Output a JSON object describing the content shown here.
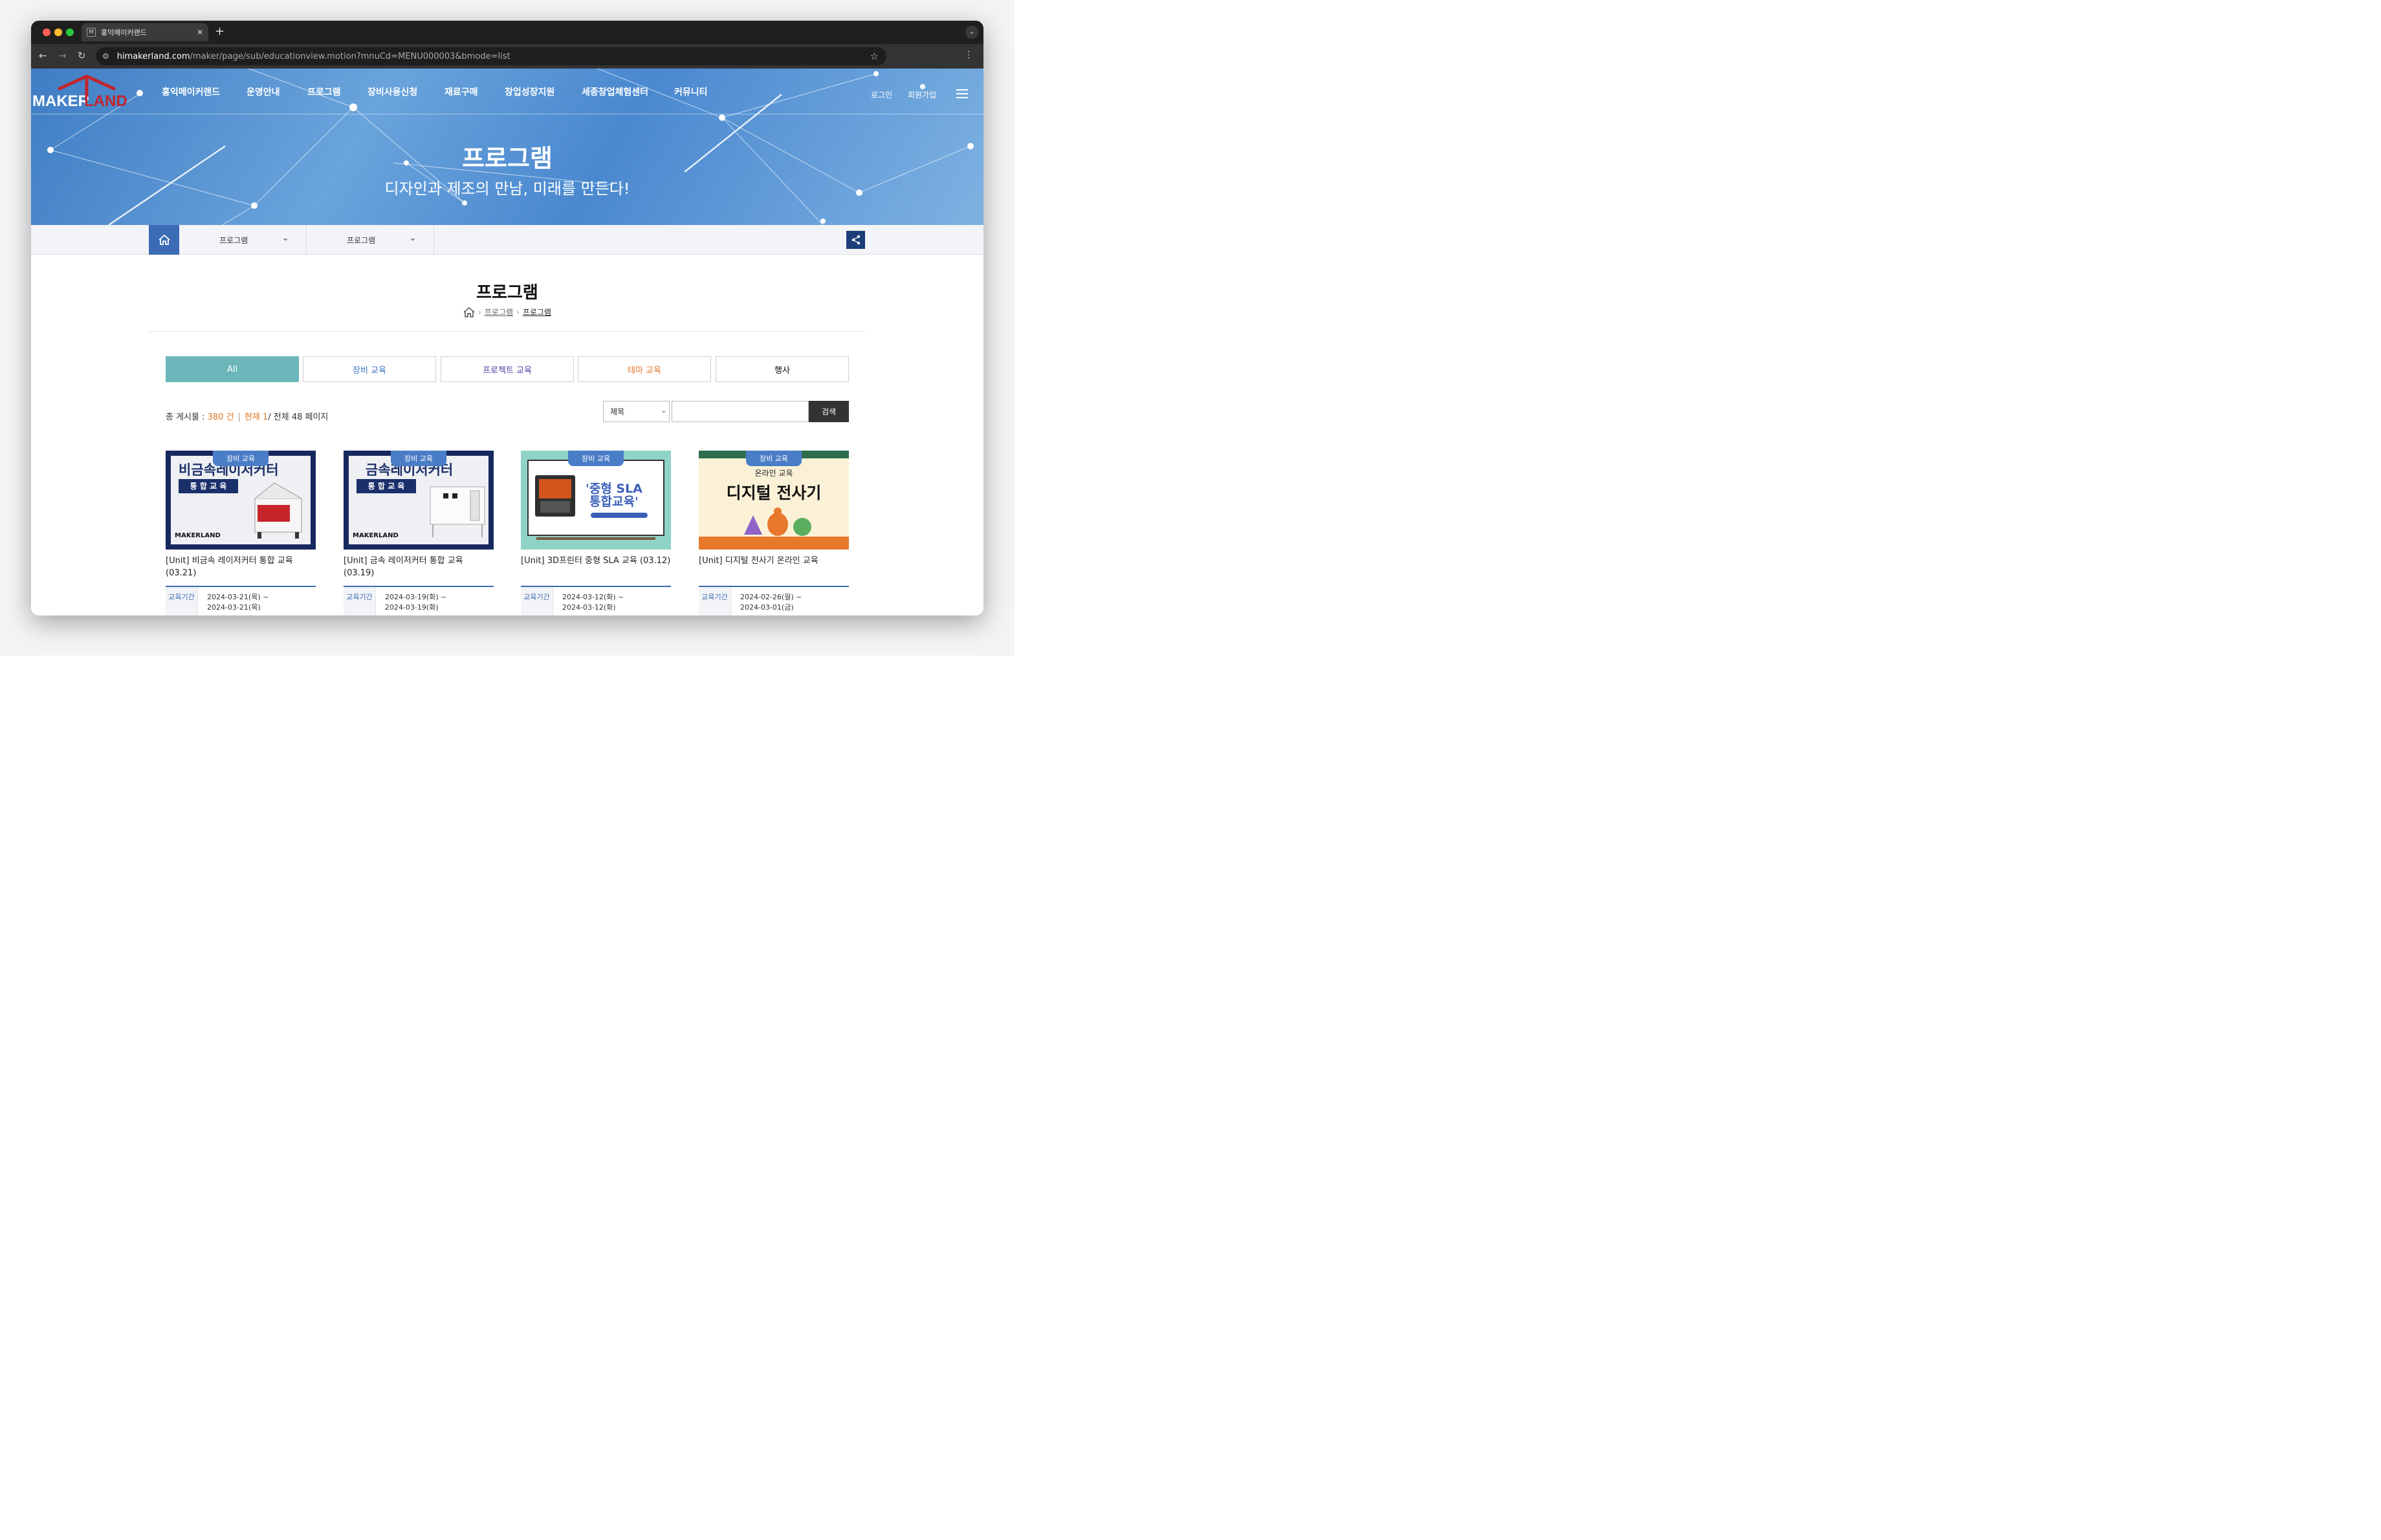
{
  "browser": {
    "tab_title": "홍익메이커랜드",
    "tab_favicon": "M",
    "new_tab": "+",
    "url_host": "himakerland.com",
    "url_path": "/maker/page/sub/educationview.motion?mnuCd=MENU000003&bmode=list"
  },
  "header": {
    "logo_text": "MAKERLAND",
    "nav": [
      "홍익메이커랜드",
      "운영안내",
      "프로그램",
      "장비사용신청",
      "재료구매",
      "창업성장지원",
      "세종창업체험센터",
      "커뮤니티"
    ],
    "login": "로그인",
    "signup": "회원가입"
  },
  "hero": {
    "title": "프로그램",
    "subtitle": "디자인과 제조의 만남, 미래를 만든다!"
  },
  "location": {
    "dropdown1": "프로그램",
    "dropdown2": "프로그램"
  },
  "page": {
    "title": "프로그램",
    "breadcrumb": [
      "프로그램",
      "프로그램"
    ]
  },
  "categories": [
    {
      "label": "All",
      "color": "#ffffff"
    },
    {
      "label": "장비 교육",
      "color": "#3a6fc3"
    },
    {
      "label": "프로젝트 교육",
      "color": "#4b3fa2"
    },
    {
      "label": "테마 교육",
      "color": "#e8782c"
    },
    {
      "label": "행사",
      "color": "#111111"
    }
  ],
  "listing": {
    "total_label": "총 게시물 : ",
    "total_value": "380 건",
    "current_label": "현재 1",
    "pages_label": "/ 전체 48 페이지"
  },
  "search": {
    "field": "제목",
    "button": "검색",
    "value": ""
  },
  "cards": [
    {
      "badge": "장비 교육",
      "title": "[Unit] 비금속 레이저커터 통합 교육 (03.21)",
      "thumb_heading": "비금속레이저커터",
      "thumb_sub": "통 합 교 육",
      "thumb_logo": "MAKERLAND",
      "period_label": "교육기간",
      "period_start": "2024-03-21(목) ~",
      "period_end": "2024-03-21(목)"
    },
    {
      "badge": "장비 교육",
      "title": "[Unit] 금속 레이저커터 통합 교육 (03.19)",
      "thumb_heading": "금속레이저커터",
      "thumb_sub": "통 합 교 육",
      "thumb_logo": "MAKERLAND",
      "period_label": "교육기간",
      "period_start": "2024-03-19(화) ~",
      "period_end": "2024-03-19(화)"
    },
    {
      "badge": "장비 교육",
      "title": "[Unit] 3D프린터 중형 SLA 교육 (03.12)",
      "thumb_heading": "'중형 SLA",
      "thumb_heading2": "통합교육'",
      "period_label": "교육기간",
      "period_start": "2024-03-12(화) ~",
      "period_end": "2024-03-12(화)"
    },
    {
      "badge": "장비 교육",
      "title": "[Unit] 디지털 전사기 온라인 교육",
      "thumb_sub": "온라인 교육",
      "thumb_heading": "디지털 전사기",
      "period_label": "교육기간",
      "period_start": "2024-02-26(월) ~",
      "period_end": "2024-03-01(금)"
    }
  ],
  "colors": {
    "accent": "#3c6bb5",
    "active_tab": "#6bb6b9",
    "highlight": "#e0771f",
    "share": "#1c3f7a"
  },
  "icons": [
    "back-arrow-icon",
    "forward-arrow-icon",
    "reload-icon",
    "site-settings-icon",
    "star-icon",
    "kebab-menu-icon",
    "hamburger-icon",
    "home-icon",
    "chevron-down-icon",
    "share-icon"
  ]
}
